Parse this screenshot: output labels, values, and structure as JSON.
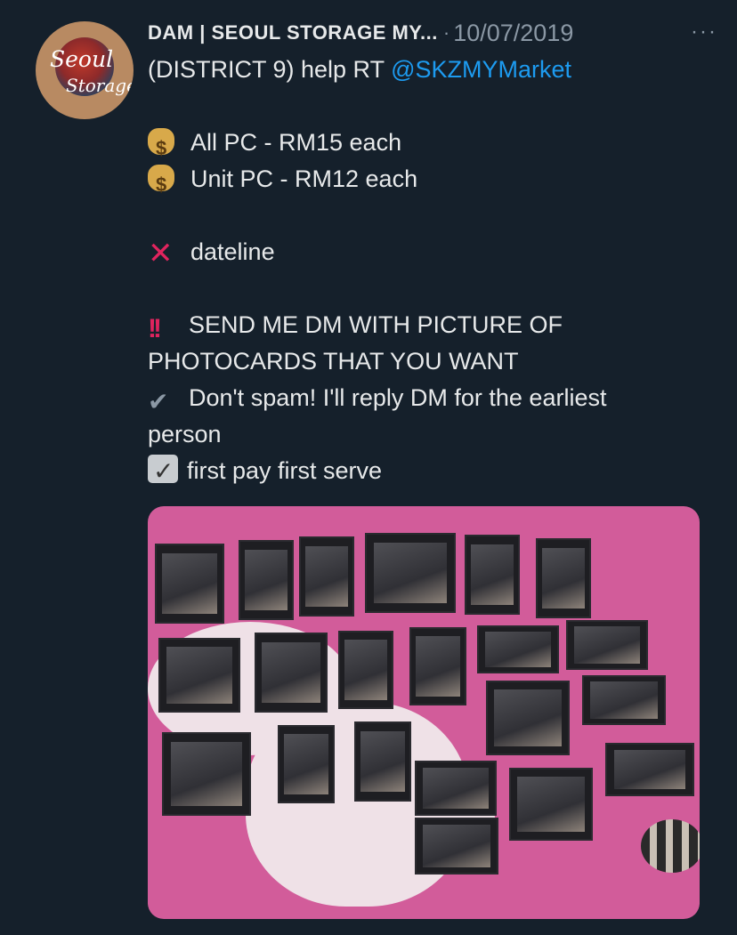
{
  "avatar": {
    "line1": "Seoul",
    "line2": "Storage"
  },
  "tweet": {
    "author": "DAM | SEOUL STORAGE MY...",
    "separator": "·",
    "date": "10/07/2019",
    "more": "···",
    "intro": "(DISTRICT 9) help RT",
    "mention": "@SKZMYMarket",
    "price_all": "All PC - RM15 each",
    "price_unit": "Unit PC - RM12 each",
    "dateline": "dateline",
    "dm_line1": "SEND ME DM WITH PICTURE OF",
    "dm_line2": "PHOTOCARDS THAT YOU WANT",
    "spam_line1": "Don't spam! I'll reply DM for the earliest",
    "spam_line2": "person",
    "serve": "first pay first serve"
  },
  "icons": {
    "price": "money-bag-icon",
    "dateline": "cross-mark-icon",
    "dm": "double-exclamation-icon",
    "spam": "check-mark-icon",
    "serve": "check-box-icon",
    "more": "more-options-icon"
  },
  "colors": {
    "background": "#15202b",
    "accent": "#1d9bf0",
    "secondary_text": "#8b98a5"
  }
}
